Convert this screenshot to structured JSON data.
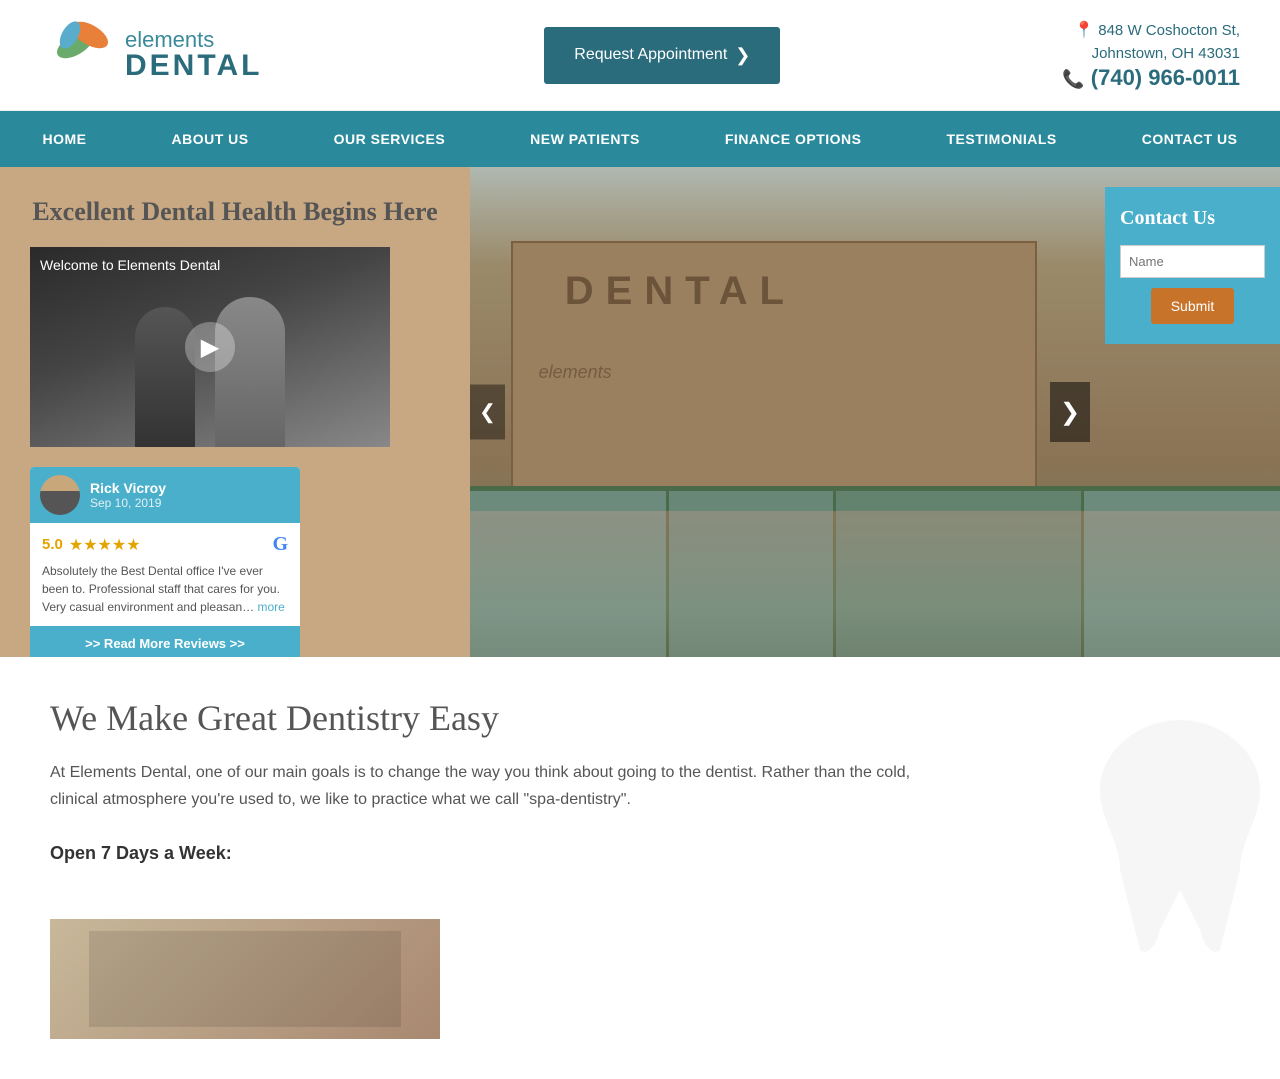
{
  "header": {
    "brand_name_part1": "elements",
    "brand_name_part2": "DENTAL",
    "appt_button": "Request Appointment",
    "address_line1": "848 W Coshocton St,",
    "address_line2": "Johnstown, OH 43031",
    "phone": "(740) 966-0011"
  },
  "nav": {
    "items": [
      {
        "label": "HOME",
        "id": "home"
      },
      {
        "label": "ABOUT US",
        "id": "about"
      },
      {
        "label": "OUR SERVICES",
        "id": "services"
      },
      {
        "label": "NEW PATIENTS",
        "id": "new-patients"
      },
      {
        "label": "FINANCE OPTIONS",
        "id": "finance"
      },
      {
        "label": "TESTIMONIALS",
        "id": "testimonials"
      },
      {
        "label": "CONTACT US",
        "id": "contact"
      }
    ]
  },
  "hero": {
    "title": "Excellent Dental Health Begins Here",
    "video_label": "Welcome to Elements Dental",
    "contact_panel_title": "Contact Us",
    "contact_input_placeholder": "Name",
    "submit_label": "Submit",
    "arrow_right": "❯",
    "arrow_left": "❮"
  },
  "review": {
    "reviewer_name": "Rick Vicroy",
    "reviewer_date": "Sep 10, 2019",
    "rating": "5.0",
    "stars": "★★★★★",
    "text": "Absolutely the Best Dental office I've ever been to. Professional staff that cares for you. Very casual environment and pleasan…",
    "more_label": "more",
    "read_more_label": ">> Read More Reviews >>"
  },
  "content": {
    "title": "We Make Great Dentistry Easy",
    "body": "At Elements Dental, one of our main goals is to change the way you think about going to the dentist. Rather than the cold, clinical atmosphere you're used to, we like to practice what we call \"spa-dentistry\".",
    "open_label": "Open 7 Days a Week:"
  }
}
